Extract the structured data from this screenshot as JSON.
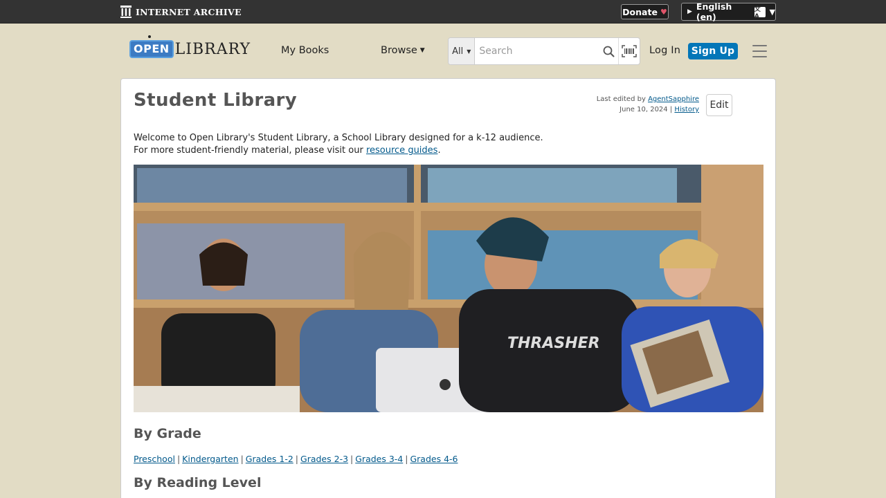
{
  "ia_bar": {
    "logo_text": "INTERNET ARCHIVE",
    "donate_label": "Donate",
    "donate_heart": "♥",
    "language_label": "English (en)"
  },
  "header": {
    "logo_open": "OPEN",
    "logo_library": "LIBRARY",
    "my_books": "My Books",
    "browse": "Browse",
    "search_scope": "All",
    "search_placeholder": "Search",
    "login": "Log In",
    "signup": "Sign Up"
  },
  "page": {
    "title": "Student Library",
    "last_edited_prefix": "Last edited by",
    "editor": "AgentSapphire",
    "edit_date": "June 10, 2024",
    "edit_sep": "|",
    "history": "History",
    "edit_button": "Edit",
    "intro_line1": "Welcome to Open Library's Student Library, a School Library designed for a k-12 audience.",
    "intro_line2_prefix": "For more student-friendly material, please visit our",
    "intro_link": "resource guides",
    "intro_line2_suffix": ".",
    "hero_alt": "Students reading in a library",
    "by_grade_heading": "By Grade",
    "grades": [
      "Preschool",
      "Kindergarten",
      "Grades 1-2",
      "Grades 2-3",
      "Grades 3-4",
      "Grades 4-6"
    ],
    "grade_separator": "|",
    "by_reading_level_heading": "By Reading Level"
  },
  "colors": {
    "page_bg": "#e2dcc5",
    "ia_bar": "#333333",
    "signup": "#0376b8",
    "link": "#02598b",
    "heading": "#555555"
  }
}
